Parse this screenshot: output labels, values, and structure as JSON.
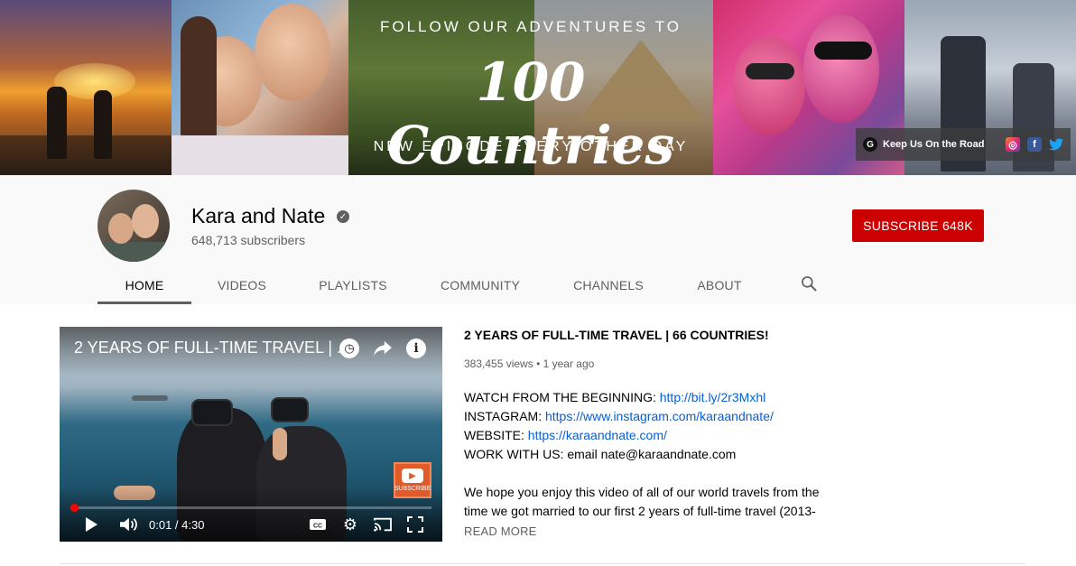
{
  "banner": {
    "top_line": "FOLLOW OUR ADVENTURES TO",
    "headline": "100 Countries",
    "subline": "NEW EPISODE EVERY OTHER DAY",
    "link_label": "Keep Us On the Road",
    "link_icon_letter": "G",
    "social_icons": [
      "instagram-icon",
      "facebook-icon",
      "twitter-icon"
    ]
  },
  "channel": {
    "name": "Kara and Nate",
    "subscribers": "648,713 subscribers",
    "subscribe_label": "SUBSCRIBE  648K",
    "accent_color": "#cc0000"
  },
  "tabs": [
    {
      "label": "HOME",
      "active": true
    },
    {
      "label": "VIDEOS"
    },
    {
      "label": "PLAYLISTS"
    },
    {
      "label": "COMMUNITY"
    },
    {
      "label": "CHANNELS"
    },
    {
      "label": "ABOUT"
    }
  ],
  "player": {
    "title": "2 YEARS OF FULL-TIME TRAVEL | ...",
    "time": "0:01 / 4:30",
    "progress_fraction": 0.004,
    "watermark_label": "SUBSCRIBE"
  },
  "featured": {
    "title": "2 YEARS OF FULL-TIME TRAVEL | 66 COUNTRIES!",
    "views": "383,455 views",
    "separator": "•",
    "age": "1 year ago",
    "lines": [
      {
        "label": "WATCH FROM THE BEGINNING: ",
        "link": "http://bit.ly/2r3Mxhl"
      },
      {
        "label": "INSTAGRAM: ",
        "link": "https://www.instagram.com/karaandnate/"
      },
      {
        "label": "WEBSITE: ",
        "link": "https://karaandnate.com/"
      },
      {
        "label": "WORK WITH US: email nate@karaandnate.com",
        "link": ""
      }
    ],
    "paragraph": "We hope you enjoy this video of all of our world travels from the time we got married to our first 2 years of full-time travel (2013-",
    "read_more": "READ MORE"
  }
}
